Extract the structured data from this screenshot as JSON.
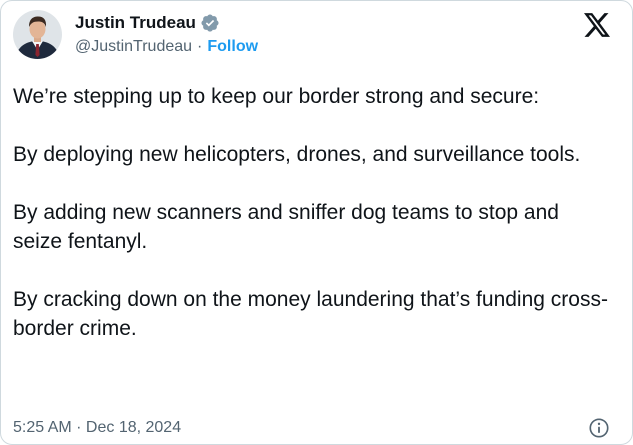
{
  "author": {
    "display_name": "Justin Trudeau",
    "handle": "@JustinTrudeau",
    "separator": "·",
    "follow_label": "Follow",
    "verified_icon": "verified-badge-icon"
  },
  "platform_icon": "x-logo-icon",
  "tweet": {
    "paragraphs": [
      "We’re stepping up to keep our border strong and secure:",
      "By deploying new helicopters, drones, and surveillance tools.",
      "By adding new scanners and sniffer dog teams to stop and seize fentanyl.",
      "By cracking down on the money laundering that’s funding cross-border crime."
    ]
  },
  "footer": {
    "timestamp": "5:25 AM · Dec 18, 2024",
    "info_icon": "info-icon"
  },
  "colors": {
    "text": "#0f1419",
    "secondary": "#536471",
    "accent": "#1d9bf0",
    "border": "#cfd9de"
  }
}
